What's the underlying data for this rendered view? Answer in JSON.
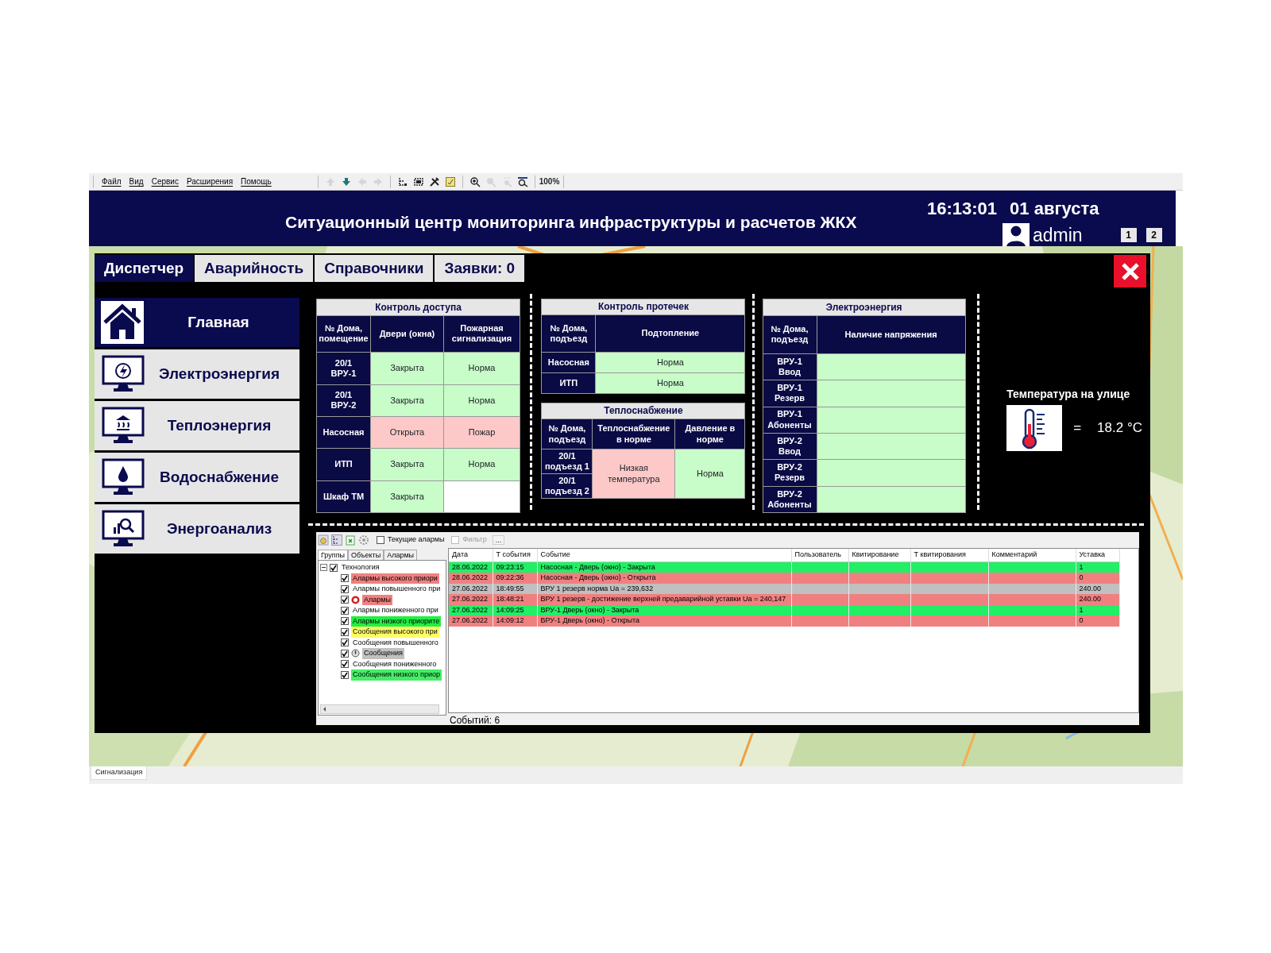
{
  "menu": [
    "Файл",
    "Вид",
    "Сервис",
    "Расширения",
    "Помощь"
  ],
  "toolbar": [
    {
      "kind": "up",
      "disabled": true
    },
    {
      "kind": "down",
      "disabled": false
    },
    {
      "kind": "left",
      "disabled": true
    },
    {
      "kind": "right",
      "disabled": true
    },
    {
      "kind": "tree",
      "disabled": false
    },
    {
      "kind": "fit",
      "disabled": false
    },
    {
      "kind": "tools",
      "disabled": false
    },
    {
      "kind": "note",
      "disabled": false
    },
    {
      "kind": "zoom-in",
      "disabled": false
    },
    {
      "kind": "zoom-out",
      "disabled": true
    },
    {
      "kind": "zoom-100",
      "disabled": true
    },
    {
      "kind": "zoom-fit",
      "disabled": false
    }
  ],
  "zoom": "100%",
  "header": {
    "title": "Ситуационный центр мониторинга инфраструктуры и расчетов ЖКХ",
    "time": "16:13:01",
    "date": "01 августа",
    "user": "admin",
    "screens": [
      "1",
      "2"
    ]
  },
  "tabs": [
    {
      "label": "Диспетчер",
      "selected": true
    },
    {
      "label": "Аварийность",
      "selected": false
    },
    {
      "label": "Справочники",
      "selected": false
    },
    {
      "label": "Заявки: 0",
      "selected": false
    }
  ],
  "nav": [
    {
      "label": "Главная",
      "kind": "house",
      "selected": true
    },
    {
      "label": "Электроэнергия",
      "kind": "bolt",
      "selected": false
    },
    {
      "label": "Теплоэнергия",
      "kind": "heat",
      "selected": false
    },
    {
      "label": "Водоснабжение",
      "kind": "drop",
      "selected": false
    },
    {
      "label": "Энергоанализ",
      "kind": "analysis",
      "selected": false
    }
  ],
  "access_control": {
    "title": "Контроль доступа",
    "columns": [
      "№ Дома,\nпомещение",
      "Двери (окна)",
      "Пожарная\nсигнализация"
    ],
    "rows": [
      {
        "cells": [
          {
            "text": "20/1\nВРУ-1"
          },
          {
            "text": "Закрыта",
            "color": "#c8fcc8"
          },
          {
            "text": "Норма",
            "color": "#c8fcc8"
          }
        ]
      },
      {
        "cells": [
          {
            "text": "20/1\nВРУ-2"
          },
          {
            "text": "Закрыта",
            "color": "#c8fcc8"
          },
          {
            "text": "Норма",
            "color": "#c8fcc8"
          }
        ]
      },
      {
        "cells": [
          {
            "text": "Насосная"
          },
          {
            "text": "Открыта",
            "color": "#fcc8c8"
          },
          {
            "text": "Пожар",
            "color": "#fcc8c8"
          }
        ]
      },
      {
        "cells": [
          {
            "text": "ИТП"
          },
          {
            "text": "Закрыта",
            "color": "#c8fcc8"
          },
          {
            "text": "Норма",
            "color": "#c8fcc8"
          }
        ]
      },
      {
        "cells": [
          {
            "text": "Шкаф ТМ"
          },
          {
            "text": "Закрыта",
            "color": "#c8fcc8"
          },
          {
            "color": "#ffffff"
          }
        ]
      }
    ]
  },
  "leak_control": {
    "title": "Контроль протечек",
    "columns": [
      "№ Дома,\nподъезд",
      "Подтопление"
    ],
    "rows": [
      {
        "cells": [
          {
            "text": "Насосная"
          },
          {
            "text": "Норма",
            "color": "#c8fcc8"
          }
        ]
      },
      {
        "cells": [
          {
            "text": "ИТП"
          },
          {
            "text": "Норма",
            "color": "#c8fcc8"
          }
        ]
      }
    ]
  },
  "heat_supply": {
    "title": "Теплоснабжение",
    "columns": [
      "№ Дома,\nподъезд",
      "Теплоснабжение\nв норме",
      "Давление в\nнорме"
    ],
    "rows": [
      {
        "cells": [
          {
            "text": "20/1\nподъезд 1"
          },
          {
            "text": "Низкая\nтемпература",
            "color": "#fcc8c8",
            "rowspan": 2
          },
          {
            "text": "Норма",
            "color": "#c8fcc8",
            "rowspan": 2
          }
        ]
      },
      {
        "cells": [
          {
            "text": "20/1\nподъезд 2"
          }
        ]
      }
    ]
  },
  "electricity": {
    "title": "Электроэнергия",
    "columns": [
      "№ Дома,\nподъезд",
      "Наличие напряжения"
    ],
    "rows": [
      {
        "cells": [
          {
            "text": "ВРУ-1\nВвод"
          },
          {
            "color": "#c8fcc8"
          }
        ]
      },
      {
        "cells": [
          {
            "text": "ВРУ-1\nРезерв"
          },
          {
            "color": "#c8fcc8"
          }
        ]
      },
      {
        "cells": [
          {
            "text": "ВРУ-1\nАбоненты"
          },
          {
            "color": "#c8fcc8"
          }
        ]
      },
      {
        "cells": [
          {
            "text": "ВРУ-2\nВвод"
          },
          {
            "color": "#c8fcc8"
          }
        ]
      },
      {
        "cells": [
          {
            "text": "ВРУ-2\nРезерв"
          },
          {
            "color": "#c8fcc8"
          }
        ]
      },
      {
        "cells": [
          {
            "text": "ВРУ-2\nАбоненты"
          },
          {
            "color": "#c8fcc8"
          }
        ]
      }
    ]
  },
  "temperature": {
    "label": "Температура на улице",
    "equals": "=",
    "value": "18.2 °C"
  },
  "alarms": {
    "toolbar": [
      {
        "kind": "refresh"
      },
      {
        "kind": "tree"
      },
      {
        "kind": "export"
      },
      {
        "kind": "settings"
      }
    ],
    "current_alarms": {
      "label": "Текущие алармы",
      "checked": false,
      "disabled": false
    },
    "filter": {
      "label": "Фильтр",
      "checked": false,
      "disabled": true
    },
    "more": "...",
    "side_tabs": [
      {
        "label": "Группы",
        "selected": true
      },
      {
        "label": "Объекты",
        "selected": false
      },
      {
        "label": "Алармы",
        "selected": false
      }
    ],
    "tree": {
      "label": "Технология",
      "checked": true,
      "expanded": true,
      "children": [
        {
          "label": "Алармы высокого приори",
          "checked": true,
          "color": "#f08080"
        },
        {
          "label": "Алармы повышенного при",
          "checked": true
        },
        {
          "label": "Алармы",
          "checked": true,
          "kind": "alarm",
          "color": "#f08080"
        },
        {
          "label": "Алармы пониженного при",
          "checked": true
        },
        {
          "label": "Алармы низкого приорите",
          "checked": true,
          "color": "#22ee44"
        },
        {
          "label": "Сообщения высокого при",
          "checked": true,
          "color": "#ffff66"
        },
        {
          "label": "Сообщения повышенного",
          "checked": true
        },
        {
          "label": "Сообщения",
          "checked": true,
          "kind": "message",
          "color": "#c0c0c0"
        },
        {
          "label": "Сообщения пониженного",
          "checked": true
        },
        {
          "label": "Сообщения низкого приор",
          "checked": true,
          "color": "#44ee66"
        }
      ]
    },
    "columns": [
      "Дата",
      "Т события",
      "Событие",
      "Пользователь",
      "Квитирование",
      "Т квитирования",
      "Комментарий",
      "Уставка"
    ],
    "rows": [
      {
        "color": "#22ee66",
        "date": "28.06.2022",
        "time": "09:23:15",
        "event": "Насосная - Дверь (окно) - Закрыта",
        "setpoint": "1"
      },
      {
        "color": "#f08080",
        "date": "28.06.2022",
        "time": "09:22:36",
        "event": "Насосная - Дверь (окно) - Открыта",
        "setpoint": "0"
      },
      {
        "color": "#c0c0c0",
        "date": "27.06.2022",
        "time": "18:49:55",
        "event": "ВРУ 1 резерв норма Ua = 239,632",
        "setpoint": "240.00"
      },
      {
        "color": "#f08080",
        "date": "27.06.2022",
        "time": "18:48:21",
        "event": "ВРУ 1 резерв - достижение верхней предаварийной уставки Ua = 240,147",
        "setpoint": "240.00"
      },
      {
        "color": "#22ee66",
        "date": "27.06.2022",
        "time": "14:09:25",
        "event": "ВРУ-1 Дверь (окно)  - Закрыта",
        "setpoint": "1"
      },
      {
        "color": "#f08080",
        "date": "27.06.2022",
        "time": "14:09:12",
        "event": "ВРУ-1 Дверь (окно)  - Открыта",
        "setpoint": "0"
      }
    ],
    "count": "Событий: 6"
  },
  "status_tab": "Сигнализация"
}
